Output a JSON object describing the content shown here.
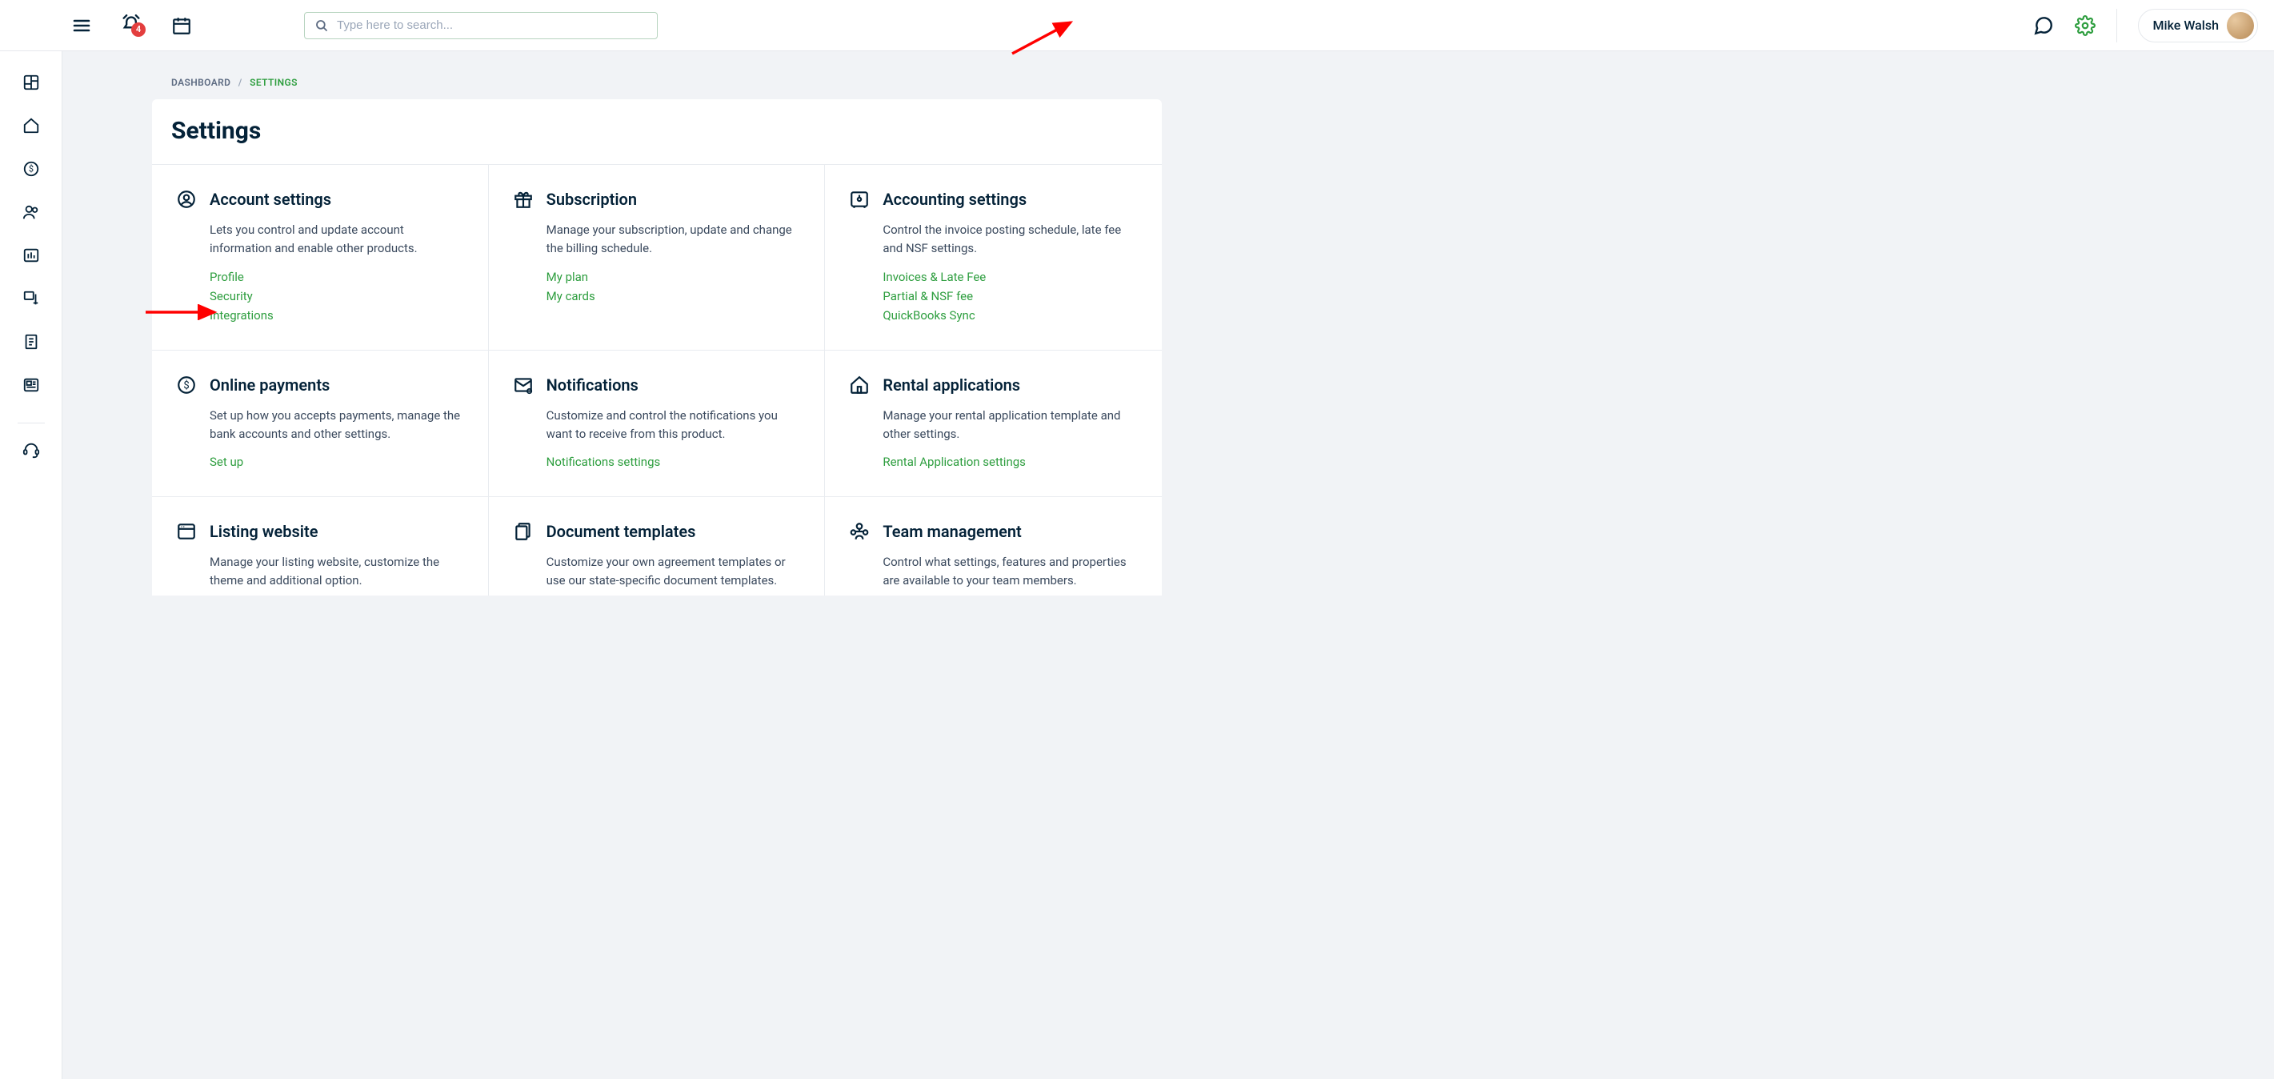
{
  "header": {
    "notification_count": "4",
    "search_placeholder": "Type here to search...",
    "user_name": "Mike Walsh"
  },
  "breadcrumb": {
    "root": "DASHBOARD",
    "current": "SETTINGS"
  },
  "page_title": "Settings",
  "sections": {
    "account": {
      "title": "Account settings",
      "desc": "Lets you control and update account information and enable other products.",
      "links": [
        "Profile",
        "Security",
        "Integrations"
      ]
    },
    "subscription": {
      "title": "Subscription",
      "desc": "Manage your subscription, update and change the billing schedule.",
      "links": [
        "My plan",
        "My cards"
      ]
    },
    "accounting": {
      "title": "Accounting settings",
      "desc": "Control the invoice posting schedule, late fee and NSF settings.",
      "links": [
        "Invoices & Late Fee",
        "Partial & NSF fee",
        "QuickBooks Sync"
      ]
    },
    "payments": {
      "title": "Online payments",
      "desc": "Set up how you accepts payments, manage the bank accounts and other settings.",
      "links": [
        "Set up"
      ]
    },
    "notifications": {
      "title": "Notifications",
      "desc": "Customize and control the notifications you want to receive from this product.",
      "links": [
        "Notifications settings"
      ]
    },
    "rental": {
      "title": "Rental applications",
      "desc": "Manage your rental application template and other settings.",
      "links": [
        "Rental Application settings"
      ]
    },
    "listing": {
      "title": "Listing website",
      "desc": "Manage your listing website, customize the theme and additional option.",
      "links": []
    },
    "documents": {
      "title": "Document templates",
      "desc": "Customize your own agreement templates or use our state-specific document templates.",
      "links": []
    },
    "team": {
      "title": "Team management",
      "desc": "Control what settings, features and properties are available to your team members.",
      "links": []
    }
  }
}
